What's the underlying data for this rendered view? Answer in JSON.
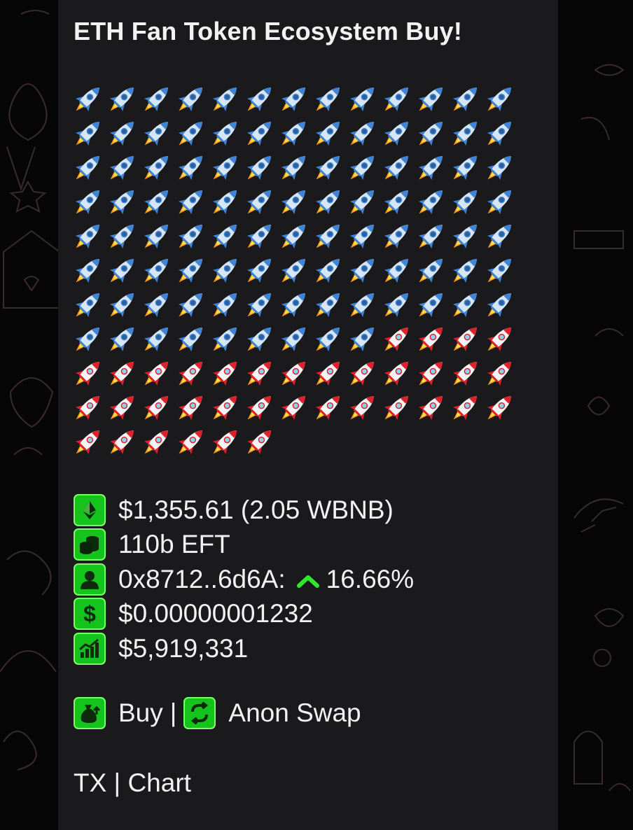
{
  "message": {
    "title": "ETH Fan Token Ecosystem Buy!",
    "rocket_rows": [
      {
        "blue": 13,
        "red": 0
      },
      {
        "blue": 13,
        "red": 0
      },
      {
        "blue": 13,
        "red": 0
      },
      {
        "blue": 13,
        "red": 0
      },
      {
        "blue": 13,
        "red": 0
      },
      {
        "blue": 13,
        "red": 0
      },
      {
        "blue": 13,
        "red": 0
      },
      {
        "blue": 9,
        "red": 4
      },
      {
        "blue": 0,
        "red": 13
      },
      {
        "blue": 0,
        "red": 13
      },
      {
        "blue": 0,
        "red": 6
      }
    ],
    "stats": {
      "spent": "$1,355.61 (2.05 WBNB)",
      "got": "110b EFT",
      "buyer": "0x8712..6d6A:",
      "position_change": "16.66%",
      "price": "$0.00000001232",
      "market_cap": "$5,919,331"
    },
    "links": {
      "buy": "Buy",
      "separator": "|",
      "anon_swap": "Anon Swap",
      "tx_chart": "TX | Chart"
    },
    "icons": {
      "spent": "ethereum-icon",
      "got": "coins-icon",
      "buyer": "user-icon",
      "price": "dollar-icon",
      "market_cap": "chart-icon",
      "buy": "money-bag-icon",
      "anon_swap": "swap-icon",
      "change": "up-arrow-icon"
    },
    "colors": {
      "bubble": "#1a1a1c",
      "icon_green": "#14c41d",
      "arrow_green": "#2ee82e",
      "text": "#f2f2f2"
    }
  }
}
